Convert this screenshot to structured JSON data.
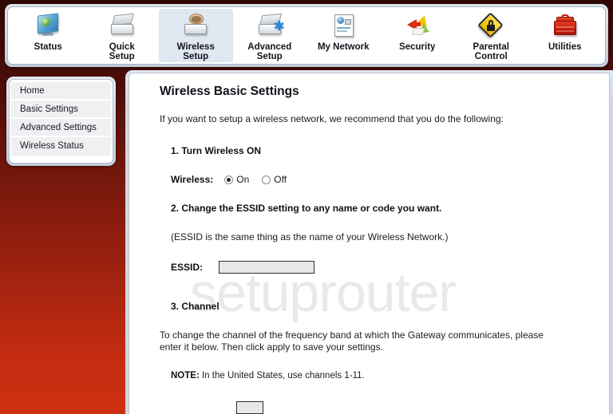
{
  "toolbar": {
    "items": [
      {
        "label": "Status",
        "icon": "status-monitor-icon",
        "active": false
      },
      {
        "label": "Quick\nSetup",
        "icon": "quick-setup-icon",
        "active": false
      },
      {
        "label": "Wireless\nSetup",
        "icon": "wireless-setup-icon",
        "active": true
      },
      {
        "label": "Advanced\nSetup",
        "icon": "advanced-setup-icon",
        "active": false
      },
      {
        "label": "My Network",
        "icon": "my-network-icon",
        "active": false
      },
      {
        "label": "Security",
        "icon": "security-icon",
        "active": false
      },
      {
        "label": "Parental\nControl",
        "icon": "parental-control-icon",
        "active": false
      },
      {
        "label": "Utilities",
        "icon": "utilities-toolbox-icon",
        "active": false
      }
    ]
  },
  "sidebar": {
    "items": [
      {
        "label": "Home"
      },
      {
        "label": "Basic Settings"
      },
      {
        "label": "Advanced Settings"
      },
      {
        "label": "Wireless Status"
      }
    ]
  },
  "main": {
    "title": "Wireless Basic Settings",
    "intro": "If you want to setup a wireless network, we recommend that you do the following:",
    "watermark": "setuprouter",
    "step1": {
      "heading": "1. Turn Wireless ON",
      "field_label": "Wireless:",
      "options": [
        {
          "label": "On",
          "selected": true
        },
        {
          "label": "Off",
          "selected": false
        }
      ]
    },
    "step2": {
      "heading": "2. Change the ESSID setting to any name or code you want.",
      "note": "(ESSID is the same thing as the name of your Wireless Network.)",
      "field_label": "ESSID:",
      "field_value": "",
      "field_placeholder": ""
    },
    "step3": {
      "heading": "3. Channel",
      "body": "To change the channel of the frequency band at which the Gateway communicates, please enter it below. Then click apply to save your settings.",
      "note_label": "NOTE:",
      "note_text": " In the United States, use channels 1-11.",
      "field_value": ""
    }
  },
  "colors": {
    "background_top": "#2e0705",
    "background_bottom": "#cf3011",
    "panel_border": "#b8c2ce",
    "active_tab": "#dfe7f0",
    "watermark": "#e9e9e9"
  }
}
